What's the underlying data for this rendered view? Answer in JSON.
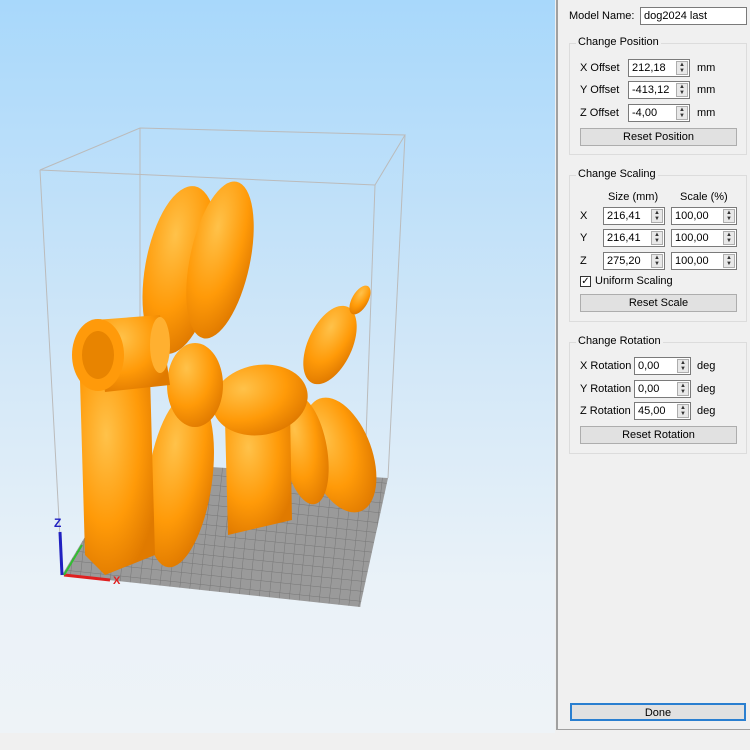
{
  "model_name": {
    "label": "Model Name:",
    "value": "dog2024 last"
  },
  "position": {
    "title": "Change Position",
    "x_label": "X Offset",
    "x_value": "212,18",
    "y_label": "Y Offset",
    "y_value": "-413,12",
    "z_label": "Z Offset",
    "z_value": "-4,00",
    "unit": "mm",
    "reset": "Reset Position"
  },
  "scaling": {
    "title": "Change Scaling",
    "size_header": "Size (mm)",
    "scale_header": "Scale (%)",
    "rows": [
      {
        "axis": "X",
        "size": "216,41",
        "scale": "100,00"
      },
      {
        "axis": "Y",
        "size": "216,41",
        "scale": "100,00"
      },
      {
        "axis": "Z",
        "size": "275,20",
        "scale": "100,00"
      }
    ],
    "uniform_label": "Uniform Scaling",
    "uniform_checked": true,
    "reset": "Reset Scale"
  },
  "rotation": {
    "title": "Change Rotation",
    "x_label": "X Rotation",
    "x_value": "0,00",
    "y_label": "Y Rotation",
    "y_value": "0,00",
    "z_label": "Z Rotation",
    "z_value": "45,00",
    "unit": "deg",
    "reset": "Reset Rotation"
  },
  "done": "Done",
  "axes": {
    "x": "X",
    "z": "Z"
  },
  "colors": {
    "model": "#ff9a0a",
    "x_axis": "#e02020",
    "y_axis": "#30c030",
    "z_axis": "#2020c0"
  }
}
